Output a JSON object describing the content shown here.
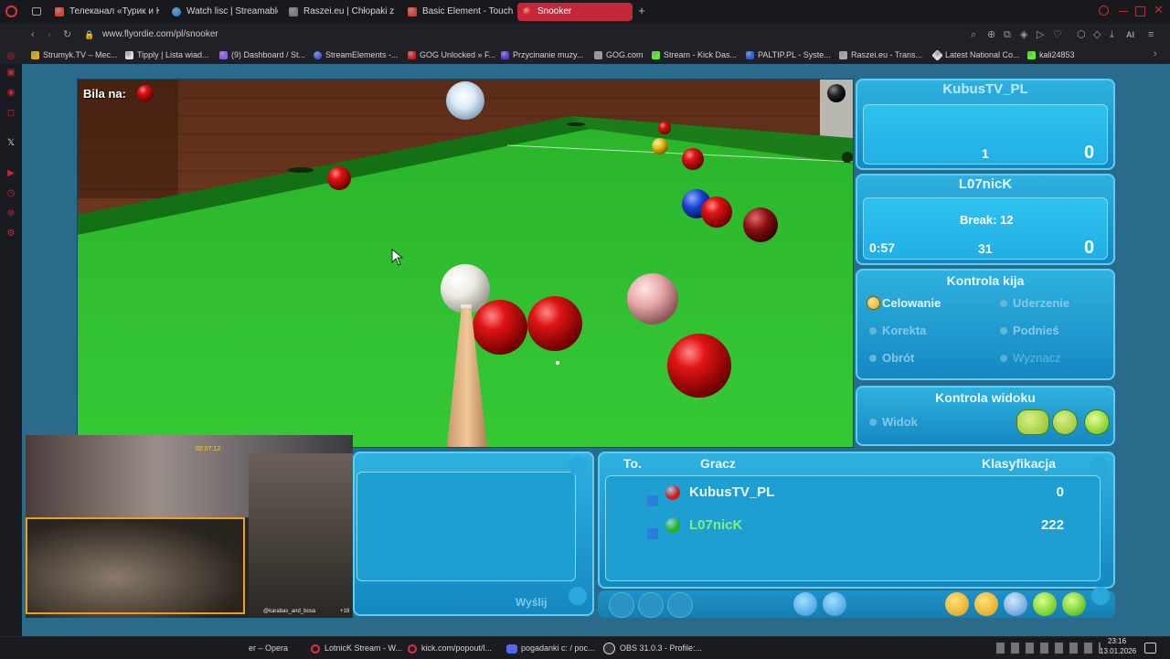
{
  "browser": {
    "tabs": [
      {
        "label": "Телеканал «Турик и Кон",
        "icon_color": "#e63b2e"
      },
      {
        "label": "Watch lisc | Streamable",
        "icon_color": "#2f8ee0"
      },
      {
        "label": "Raszei.eu | Chłopaki z Ra",
        "icon_color": "#7a7b82"
      },
      {
        "label": "Basic Element - Touch",
        "icon_color": "#e63b2e"
      },
      {
        "label": "Snooker",
        "icon_color": "#d22"
      }
    ],
    "new_tab_icon": "plus-icon",
    "url": "www.flyordie.com/pl/snooker",
    "bookmarks": [
      {
        "label": "Strumyk.TV – Mec...",
        "icon_color": "#e0b000"
      },
      {
        "label": "Tipply | Lista wiad...",
        "icon_color": "#e0e0e0"
      },
      {
        "label": "(9) Dashboard / St...",
        "icon_color": "#8a5cf0"
      },
      {
        "label": "StreamElements -...",
        "icon_color": "#4b5cf0"
      },
      {
        "label": "GOG Unlocked » F...",
        "icon_color": "#c22"
      },
      {
        "label": "Przycinanie muzy...",
        "icon_color": "#5a3dd8"
      },
      {
        "label": "GOG.com",
        "icon_color": "#9a9a9a"
      },
      {
        "label": "Stream - Kick Das...",
        "icon_color": "#53fc18"
      },
      {
        "label": "PALTIP.PL - Syste...",
        "icon_color": "#2b5fd9"
      },
      {
        "label": "Raszei.eu - Trans...",
        "icon_color": "#aaaaaa"
      },
      {
        "label": "Latest National Co...",
        "icon_color": "#dddddd"
      },
      {
        "label": "kali24853",
        "icon_color": "#53fc18"
      }
    ]
  },
  "game": {
    "bila_na_label": "Bila na:",
    "player1": {
      "name": "KubusTV_PL",
      "break_count": "1",
      "score": "0"
    },
    "player2": {
      "name": "L07nicK",
      "break_label": "Break: 12",
      "timer": "0:57",
      "break_count": "31",
      "score": "0"
    },
    "cue_control": {
      "title": "Kontrola kija",
      "options": [
        {
          "label": "Celowanie",
          "state": "selected"
        },
        {
          "label": "Uderzenie",
          "state": "normal"
        },
        {
          "label": "Korekta",
          "state": "normal"
        },
        {
          "label": "Podnieś",
          "state": "normal"
        },
        {
          "label": "Obrót",
          "state": "normal"
        },
        {
          "label": "Wyznacz",
          "state": "disabled"
        }
      ]
    },
    "view_control": {
      "title": "Kontrola widoku",
      "option": "Widok"
    },
    "chat": {
      "send_button": "Wyślij"
    },
    "ranking": {
      "col_to": "To.",
      "col_player": "Gracz",
      "col_rank": "Klasyfikacja",
      "rows": [
        {
          "player": "KubusTV_PL",
          "ball_color": "#d81818",
          "rank": "0"
        },
        {
          "player": "L07nicK",
          "ball_color": "#21b521",
          "rank": "222"
        }
      ]
    }
  },
  "webcam": {
    "time_overlay": "02:07:12",
    "handle_label": "@karabas_and_bosa",
    "count_label": "+18"
  },
  "taskbar": {
    "items": [
      {
        "label": "er – Opera"
      },
      {
        "label": "LotnicK Stream - W..."
      },
      {
        "label": "kick.com/popout/l..."
      },
      {
        "label": "pogadanki c: / poc..."
      },
      {
        "label": "OBS 31.0.3 - Profile:..."
      }
    ],
    "time": "23:16",
    "date": "13.01.2026"
  }
}
